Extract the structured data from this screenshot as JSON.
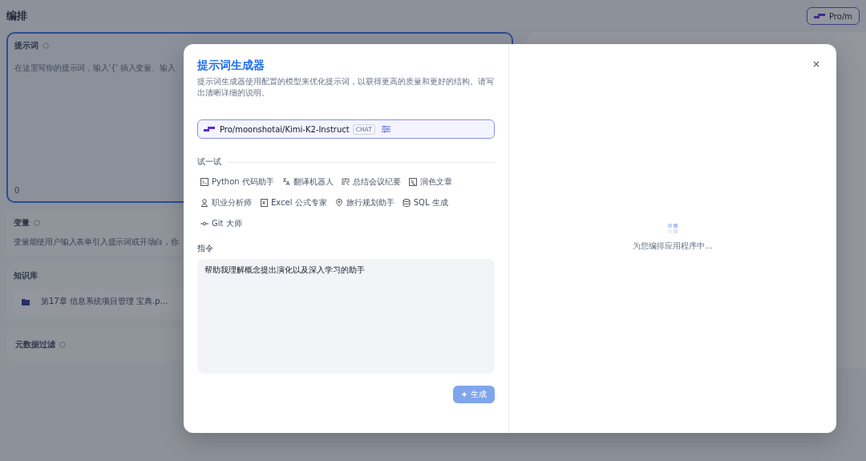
{
  "page": {
    "title": "编排",
    "model_button": "Pro/m"
  },
  "prompt_panel": {
    "label": "提示词",
    "placeholder": "在这里写你的提示词，输入'{' 插入变量、输入",
    "count": "0"
  },
  "variables": {
    "label": "变量",
    "description": "变量能使用户输入表单引入提示词或开场白，你"
  },
  "knowledge": {
    "label": "知识库",
    "items": [
      {
        "name": "第17章 信息系统项目管理 宝典.p..."
      }
    ]
  },
  "metadata_filter": {
    "label": "元数据过滤"
  },
  "dialog": {
    "title": "提示词生成器",
    "description": "提示词生成器使用配置的模型来优化提示词，以获得更高的质量和更好的结构。请写出清晰详细的说明。",
    "model": {
      "name": "Pro/moonshotai/Kimi-K2-Instruct",
      "badge": "CHAT"
    },
    "try_label": "试一试",
    "templates": [
      {
        "label": "Python 代码助手"
      },
      {
        "label": "翻译机器人"
      },
      {
        "label": "总结会议纪要"
      },
      {
        "label": "润色文章"
      },
      {
        "label": "职业分析师"
      },
      {
        "label": "Excel 公式专家"
      },
      {
        "label": "旅行规划助手"
      },
      {
        "label": "SQL 生成"
      },
      {
        "label": "Git 大师"
      }
    ],
    "instruction_label": "指令",
    "instruction_value": "帮助我理解概念提出演化以及深入学习的助手",
    "generate_button": {
      "label": "生成",
      "disabled": true
    },
    "loading_text": "为您编排应用程序中..."
  }
}
